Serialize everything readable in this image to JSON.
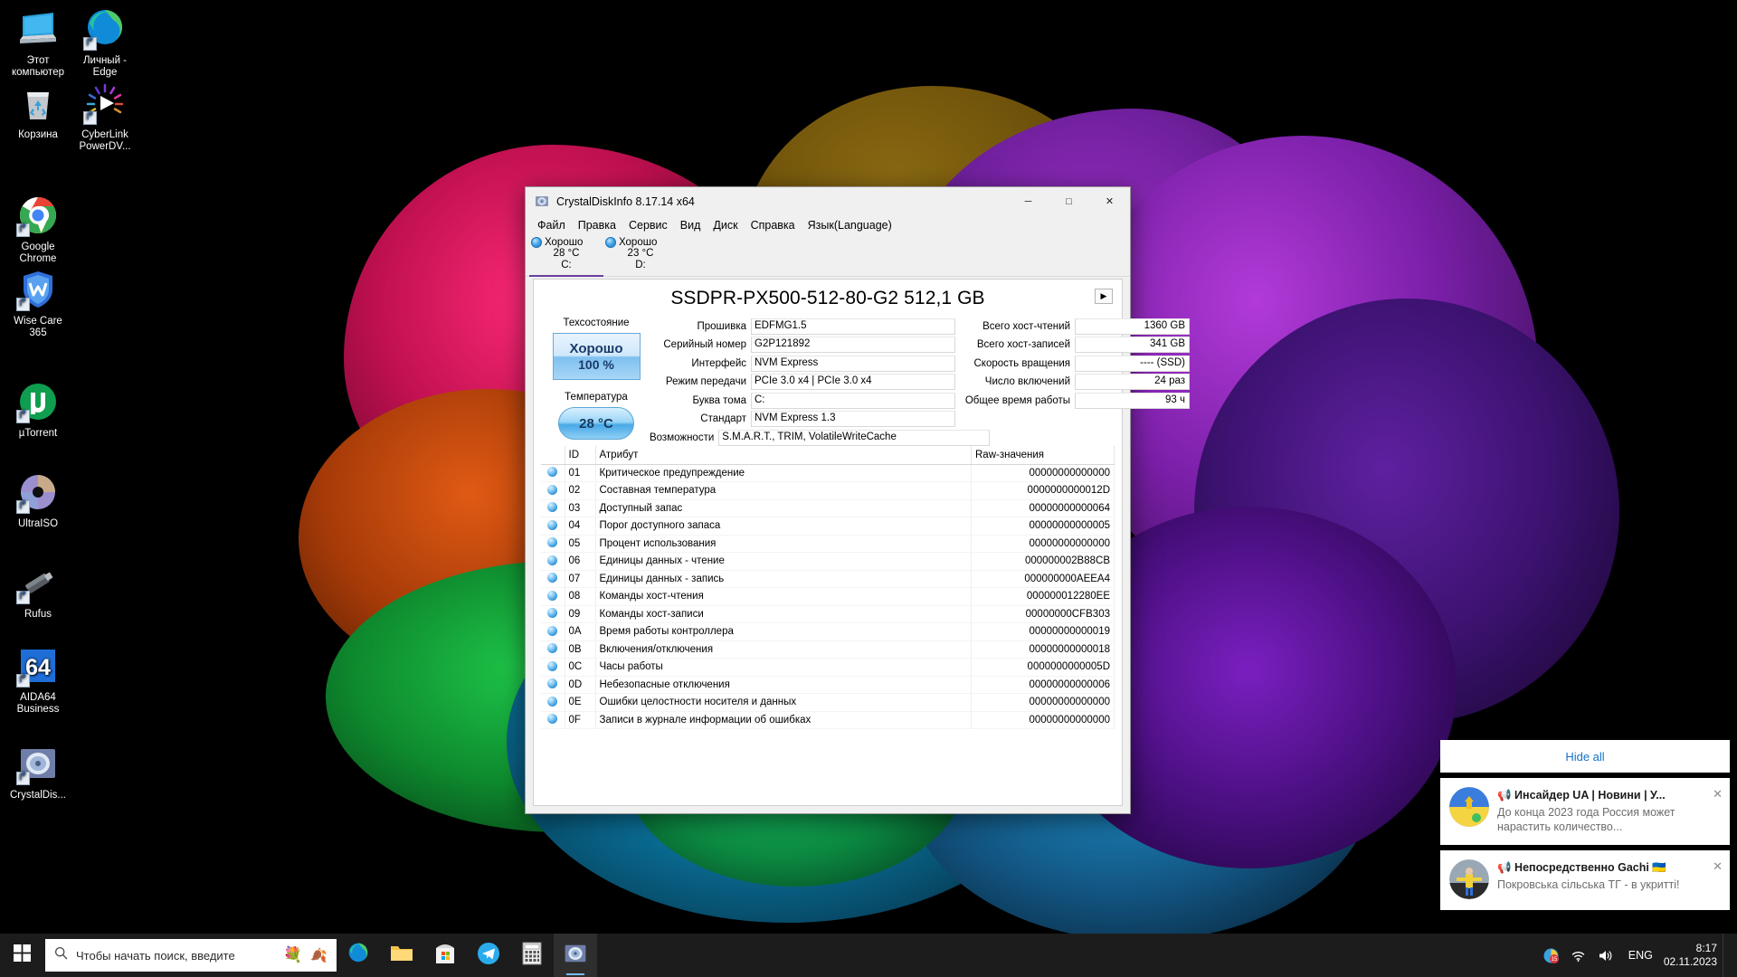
{
  "desktop": {
    "icons": [
      {
        "label": "Этот компьютер",
        "icon": "this-pc-icon",
        "shortcut": false
      },
      {
        "label": "Личный - Edge",
        "icon": "edge-icon",
        "shortcut": true
      },
      {
        "label": "Корзина",
        "icon": "recycle-bin-icon",
        "shortcut": false
      },
      {
        "label": "CyberLink PowerDV...",
        "icon": "powerdvd-icon",
        "shortcut": true
      },
      {
        "label": "Google Chrome",
        "icon": "chrome-icon",
        "shortcut": true
      },
      {
        "label": "Wise Care 365",
        "icon": "wise-care-icon",
        "shortcut": true
      },
      {
        "label": "µTorrent",
        "icon": "utorrent-icon",
        "shortcut": true
      },
      {
        "label": "UltraISO",
        "icon": "ultraiso-icon",
        "shortcut": true
      },
      {
        "label": "Rufus",
        "icon": "rufus-icon",
        "shortcut": true
      },
      {
        "label": "AIDA64 Business",
        "icon": "aida64-icon",
        "shortcut": true
      },
      {
        "label": "CrystalDis...",
        "icon": "crystaldiskinfo-icon",
        "shortcut": true
      }
    ]
  },
  "window": {
    "title": "CrystalDiskInfo 8.17.14 x64",
    "icon": "crystaldiskinfo-icon",
    "buttons": {
      "minimize": "─",
      "maximize": "□",
      "close": "✕"
    },
    "menu": [
      "Файл",
      "Правка",
      "Сервис",
      "Вид",
      "Диск",
      "Справка",
      "Язык(Language)"
    ],
    "drives": [
      {
        "status": "Хорошо",
        "temp": "28 °C",
        "letter": "C:",
        "active": true
      },
      {
        "status": "Хорошо",
        "temp": "23 °C",
        "letter": "D:",
        "active": false
      }
    ],
    "model": "SSDPR-PX500-512-80-G2 512,1 GB",
    "next_button": "▶",
    "health": {
      "caption": "Техсостояние",
      "status": "Хорошо",
      "percent": "100 %",
      "temp_caption": "Температура",
      "temp_value": "28 °C"
    },
    "fields_left": [
      {
        "label": "Прошивка",
        "value": "EDFMG1.5"
      },
      {
        "label": "Серийный номер",
        "value": "G2P121892"
      },
      {
        "label": "Интерфейс",
        "value": "NVM Express"
      },
      {
        "label": "Режим передачи",
        "value": "PCIe 3.0 x4 | PCIe 3.0 x4"
      },
      {
        "label": "Буква тома",
        "value": "C:"
      },
      {
        "label": "Стандарт",
        "value": "NVM Express 1.3"
      },
      {
        "label": "Возможности",
        "value": "S.M.A.R.T., TRIM, VolatileWriteCache"
      }
    ],
    "fields_right": [
      {
        "label": "Всего хост-чтений",
        "value": "1360 GB"
      },
      {
        "label": "Всего хост-записей",
        "value": "341 GB"
      },
      {
        "label": "Скорость вращения",
        "value": "---- (SSD)"
      },
      {
        "label": "Число включений",
        "value": "24 раз"
      },
      {
        "label": "Общее время работы",
        "value": "93 ч"
      }
    ],
    "table": {
      "headers": {
        "bulb": "",
        "id": "ID",
        "name": "Атрибут",
        "raw": "Raw-значения"
      },
      "rows": [
        {
          "id": "01",
          "name": "Критическое предупреждение",
          "raw": "00000000000000"
        },
        {
          "id": "02",
          "name": "Составная температура",
          "raw": "0000000000012D"
        },
        {
          "id": "03",
          "name": "Доступный запас",
          "raw": "00000000000064"
        },
        {
          "id": "04",
          "name": "Порог доступного запаса",
          "raw": "00000000000005"
        },
        {
          "id": "05",
          "name": "Процент использования",
          "raw": "00000000000000"
        },
        {
          "id": "06",
          "name": "Единицы данных - чтение",
          "raw": "000000002B88CB"
        },
        {
          "id": "07",
          "name": "Единицы данных - запись",
          "raw": "000000000AEEA4"
        },
        {
          "id": "08",
          "name": "Команды хост-чтения",
          "raw": "000000012280EE"
        },
        {
          "id": "09",
          "name": "Команды хост-записи",
          "raw": "00000000CFB303"
        },
        {
          "id": "0A",
          "name": "Время работы контроллера",
          "raw": "00000000000019"
        },
        {
          "id": "0B",
          "name": "Включения/отключения",
          "raw": "00000000000018"
        },
        {
          "id": "0C",
          "name": "Часы работы",
          "raw": "0000000000005D"
        },
        {
          "id": "0D",
          "name": "Небезопасные отключения",
          "raw": "00000000000006"
        },
        {
          "id": "0E",
          "name": "Ошибки целостности носителя и данных",
          "raw": "00000000000000"
        },
        {
          "id": "0F",
          "name": "Записи в журнале информации об ошибках",
          "raw": "00000000000000"
        }
      ]
    }
  },
  "notifications": {
    "hide_all": "Hide all",
    "items": [
      {
        "title": "📢 Инсайдер UA | Новини | У...",
        "body": "До конца 2023 года Россия может нарастить количество...",
        "close": "✕",
        "avatar": "ukraine-flag-avatar"
      },
      {
        "title": "📢 Непосредственно Gachi 🇺🇦",
        "body": "Покровська сільська ТГ - в укритті!",
        "close": "✕",
        "avatar": "person-photo-avatar"
      }
    ]
  },
  "taskbar": {
    "start_icon": "windows-start-icon",
    "search": {
      "icon": "search-icon",
      "placeholder": "Чтобы начать поиск, введите"
    },
    "apps": [
      {
        "name": "edge-taskbar-icon",
        "active": false
      },
      {
        "name": "file-explorer-taskbar-icon",
        "active": false
      },
      {
        "name": "microsoft-store-taskbar-icon",
        "active": false
      },
      {
        "name": "telegram-taskbar-icon",
        "active": false
      },
      {
        "name": "calculator-taskbar-icon",
        "active": false
      },
      {
        "name": "crystaldiskinfo-taskbar-icon",
        "active": true
      }
    ],
    "tray": {
      "icons": [
        "antivirus-icon",
        "wifi-icon",
        "volume-icon"
      ],
      "language": "ENG",
      "time": "8:17",
      "date": "02.11.2023"
    }
  },
  "colors": {
    "accent": "#6b3fa0",
    "link": "#1271c7",
    "taskbar_bg": "#1c1c1c",
    "window_bg": "#f0f0f0"
  }
}
